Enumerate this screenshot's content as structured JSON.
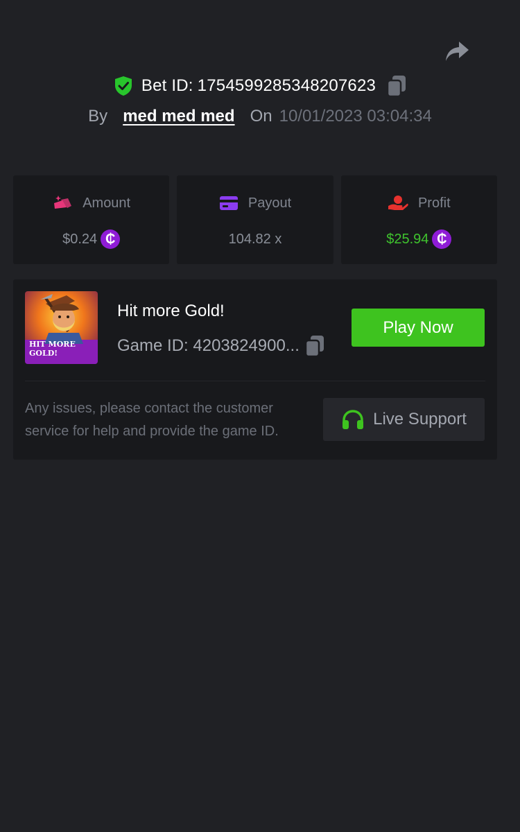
{
  "header": {
    "bet_id_label": "Bet ID:",
    "bet_id": "1754599285348207623",
    "by_label": "By",
    "username": "med med med",
    "on_label": "On",
    "datetime": "10/01/2023 03:04:34"
  },
  "stats": {
    "amount": {
      "label": "Amount",
      "value": "$0.24",
      "icon": "coins-icon",
      "icon_color": "#e8367a"
    },
    "payout": {
      "label": "Payout",
      "value": "104.82 x",
      "icon": "card-icon",
      "icon_color": "#8b3cf0"
    },
    "profit": {
      "label": "Profit",
      "value": "$25.94",
      "icon": "hand-coin-icon",
      "icon_color": "#e6322e",
      "value_color": "#3fc42e"
    }
  },
  "coin_symbol": "₵",
  "game": {
    "title": "Hit more Gold!",
    "id_label": "Game ID:",
    "id_truncated": "4203824900...",
    "thumbnail_text": "HIT MORE GOLD!",
    "play_label": "Play Now",
    "help_text": "Any issues, please contact the customer service for help and provide the game ID.",
    "support_label": "Live Support"
  },
  "colors": {
    "background": "#202125",
    "card": "#18191c",
    "accent_green": "#3ec31f",
    "coin_purple": "#8f1cd6"
  }
}
